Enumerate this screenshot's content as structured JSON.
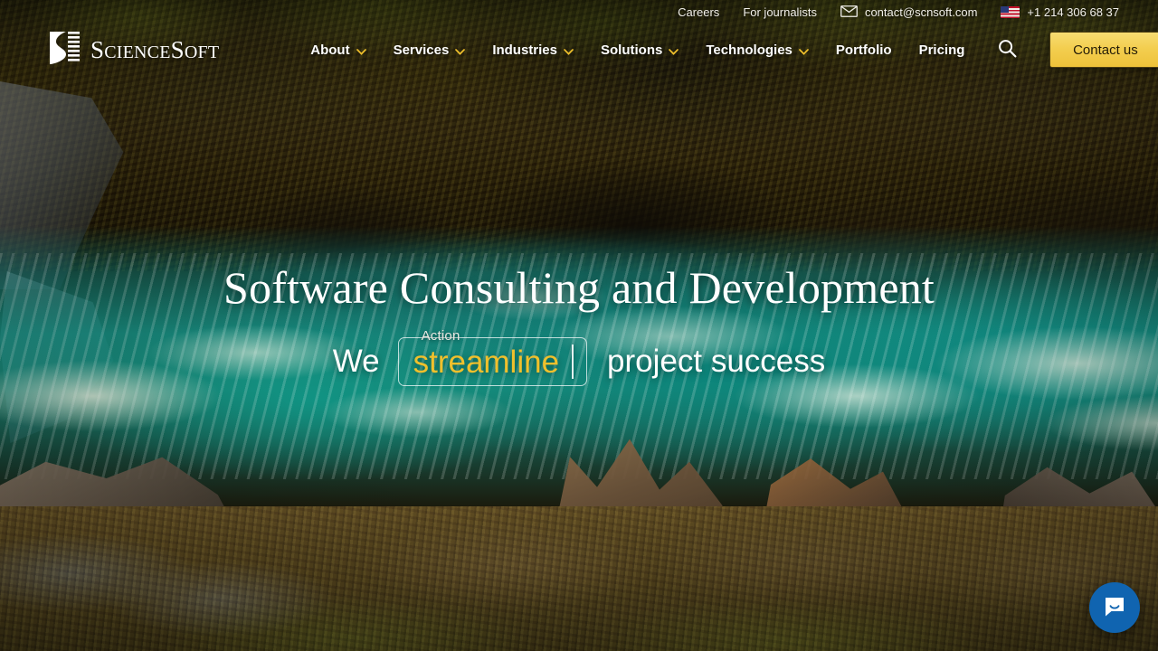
{
  "topbar": {
    "careers_label": "Careers",
    "journalists_label": "For journalists",
    "email": "contact@scnsoft.com",
    "phone": "+1 214 306 68 37",
    "email_icon": "envelope-icon",
    "flag_icon": "us-flag-icon"
  },
  "brand": {
    "name_part1": "S",
    "name_part2": "CIENCE",
    "name_part3": "S",
    "name_part4": "OFT",
    "full_name": "ScienceSoft",
    "logo_icon": "sciencesoft-logo-mark"
  },
  "nav": {
    "items": [
      {
        "label": "About",
        "has_dropdown": true
      },
      {
        "label": "Services",
        "has_dropdown": true
      },
      {
        "label": "Industries",
        "has_dropdown": true
      },
      {
        "label": "Solutions",
        "has_dropdown": true
      },
      {
        "label": "Technologies",
        "has_dropdown": true
      },
      {
        "label": "Portfolio",
        "has_dropdown": false
      },
      {
        "label": "Pricing",
        "has_dropdown": false
      }
    ],
    "search_icon": "search-icon",
    "cta_label": "Contact us"
  },
  "hero": {
    "title": "Software Consulting and Development",
    "subtitle_prefix": "We",
    "subtitle_suffix": "project success",
    "field_legend": "Action",
    "field_value": "streamline"
  },
  "chat": {
    "icon": "chat-bubble-icon",
    "aria_label": "Open chat"
  },
  "colors": {
    "accent_gold": "#f0c02c",
    "cta_gold": "#f3ce4f",
    "chat_blue": "#1064b0",
    "text_white": "#ffffff",
    "water_teal": "#169a8e"
  }
}
